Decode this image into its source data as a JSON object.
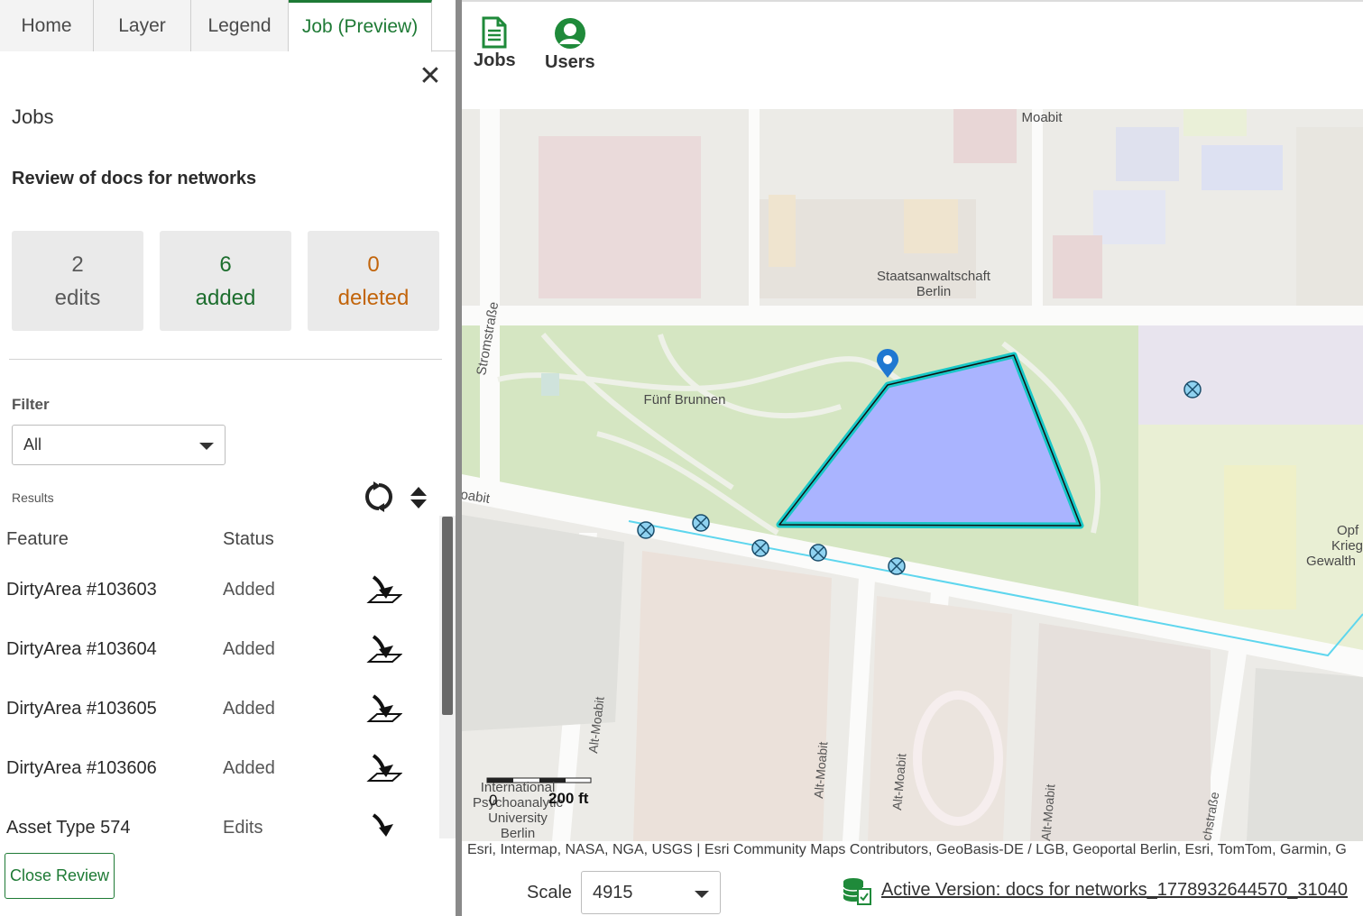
{
  "tabs": [
    {
      "label": "Home"
    },
    {
      "label": "Layer"
    },
    {
      "label": "Legend"
    },
    {
      "label": "Job (Preview)",
      "active": true
    }
  ],
  "panel": {
    "title": "Jobs",
    "job_name": "Review of docs for networks",
    "stats": [
      {
        "value": "2",
        "label": "edits",
        "color": "#5a5a5a"
      },
      {
        "value": "6",
        "label": "added",
        "color": "#1d6e2e"
      },
      {
        "value": "0",
        "label": "deleted",
        "color": "#c2650c"
      }
    ],
    "filter_label": "Filter",
    "filter_value": "All",
    "results_label": "Results",
    "columns": {
      "feature": "Feature",
      "status": "Status"
    },
    "results": [
      {
        "feature": "DirtyArea #103603",
        "status": "Added"
      },
      {
        "feature": "DirtyArea #103604",
        "status": "Added"
      },
      {
        "feature": "DirtyArea #103605",
        "status": "Added"
      },
      {
        "feature": "DirtyArea #103606",
        "status": "Added"
      },
      {
        "feature": "Asset Type 574",
        "status": "Edits"
      }
    ],
    "close_review": "Close Review"
  },
  "toolbar": {
    "jobs": "Jobs",
    "users": "Users"
  },
  "map": {
    "labels": {
      "moabit": "Moabit",
      "staats_1": "Staatsanwaltschaft",
      "staats_2": "Berlin",
      "fuenf": "Fünf Brunnen",
      "strom": "Stromstraße",
      "moabit_road": "oabit",
      "alt_moabit_1": "Alt-Moabit",
      "alt_moabit_2": "Alt-Moabit",
      "alt_moabit_3": "Alt-Moabit",
      "alt_moabit_4": "Alt-Moabit",
      "opfer_1": "Opf",
      "opfer_2": "Krieg",
      "opfer_3": "Gewalth",
      "ipu_1": "International",
      "ipu_2": "Psychoanalytic",
      "ipu_3": "University",
      "ipu_4": "Berlin",
      "kirch": "chstraße"
    },
    "scalebar": {
      "zero": "0",
      "distance": "200 ft"
    },
    "attribution": "Esri, Intermap, NASA, NGA, USGS | Esri Community Maps Contributors, GeoBasis-DE / LGB, Geoportal Berlin, Esri, TomTom, Garmin, G",
    "polygon_fill": "#aab4ff",
    "polygon_outline": "#19c7c7"
  },
  "status": {
    "scale_label": "Scale",
    "scale_value": "4915",
    "version": "Active Version: docs for networks_1778932644570_31040"
  },
  "colors": {
    "accent": "#1e7a35",
    "added": "#1d6e2e",
    "deleted": "#c2650c"
  }
}
